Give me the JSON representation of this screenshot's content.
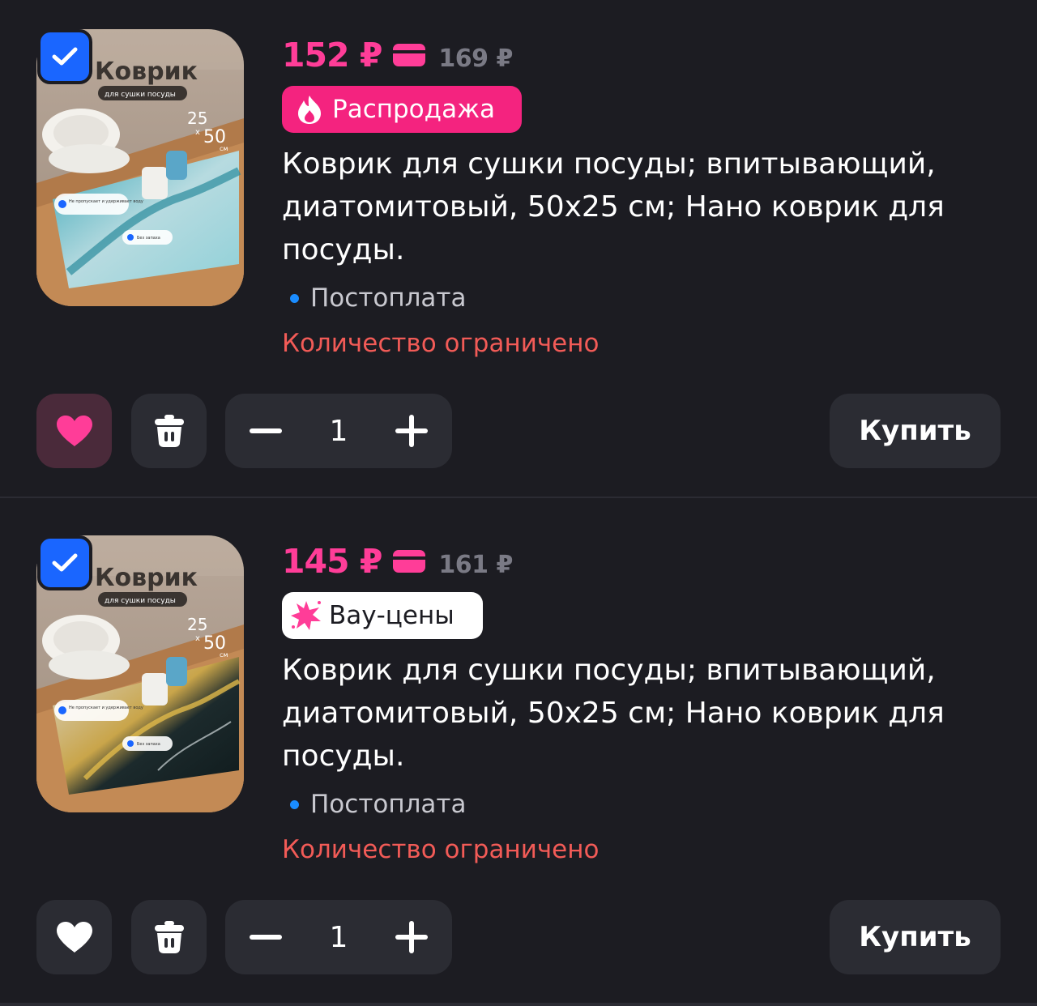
{
  "colors": {
    "background": "#1c1c22",
    "price": "#ff3d98",
    "old_price": "#7a7a85",
    "sale_badge": "#f4237f",
    "limited": "#f25b57",
    "checkbox": "#1a66ff",
    "button_bg": "#2b2c33"
  },
  "items": [
    {
      "checked": true,
      "image_texts": {
        "brand": "Коврик",
        "subtitle": "для сушки посуды",
        "size_a": "25",
        "size_x": "x",
        "size_b": "50",
        "unit": "см",
        "callout_1": "Не пропускает и удерживает воду",
        "callout_2": "Без запаха"
      },
      "price": "152 ₽",
      "old_price": "169 ₽",
      "badge": {
        "icon": "fire-icon",
        "label": "Распродажа"
      },
      "title": "Коврик для сушки посуды; впитывающий, диатомитовый, 50х25 см; Нано коврик для посуды.",
      "payment": "Постоплата",
      "stock_note": "Количество ограничено",
      "favorite": true,
      "quantity": "1",
      "buy_label": "Купить"
    },
    {
      "checked": true,
      "image_texts": {
        "brand": "Коврик",
        "subtitle": "для сушки посуды",
        "size_a": "25",
        "size_x": "x",
        "size_b": "50",
        "unit": "см",
        "callout_1": "Не пропускает и удерживает воду",
        "callout_2": "Без запаха"
      },
      "price": "145 ₽",
      "old_price": "161 ₽",
      "badge": {
        "icon": "star-burst-icon",
        "label": "Вау-цены"
      },
      "title": "Коврик для сушки посуды; впитывающий, диатомитовый, 50х25 см; Нано коврик для посуды.",
      "payment": "Постоплата",
      "stock_note": "Количество ограничено",
      "favorite": false,
      "quantity": "1",
      "buy_label": "Купить"
    }
  ]
}
